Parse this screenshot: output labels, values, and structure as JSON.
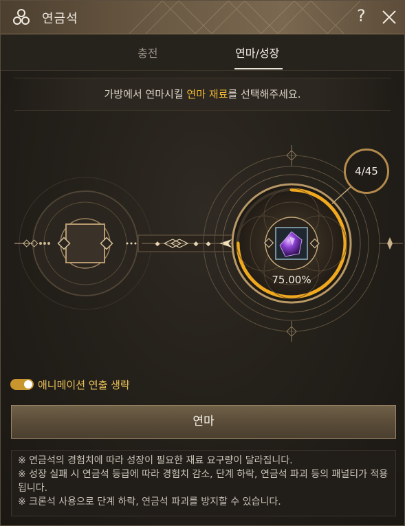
{
  "window": {
    "title": "연금석",
    "help_label": "?"
  },
  "tabs": [
    {
      "label": "충전",
      "active": false
    },
    {
      "label": "연마/성장",
      "active": true
    }
  ],
  "instruction": {
    "before": "가방에서 연마시킬 ",
    "highlight": "연마 재료",
    "after": "를 선택해주세요."
  },
  "progress": {
    "percent_label": "75.00%",
    "fraction": 0.75,
    "count_label": "4/45"
  },
  "toggle": {
    "label": "애니메이션 연출 생략",
    "on": true
  },
  "main_button": {
    "label": "연마"
  },
  "notes": [
    "※ 연금석의 경험치에 따라 성장이 필요한 재료 요구량이 달라집니다.",
    "※ 성장 실패 시 연금석 등급에 따라 경험치 감소, 단계 하락, 연금석 파괴 등의 패널티가 적용됩니다.",
    "※ 크론석 사용으로 단계 하락, 연금석 파괴를 방지할 수 있습니다."
  ],
  "colors": {
    "accent": "#f1b934",
    "progress_ring": "#f0a81e",
    "toggle": "#c9952e"
  }
}
